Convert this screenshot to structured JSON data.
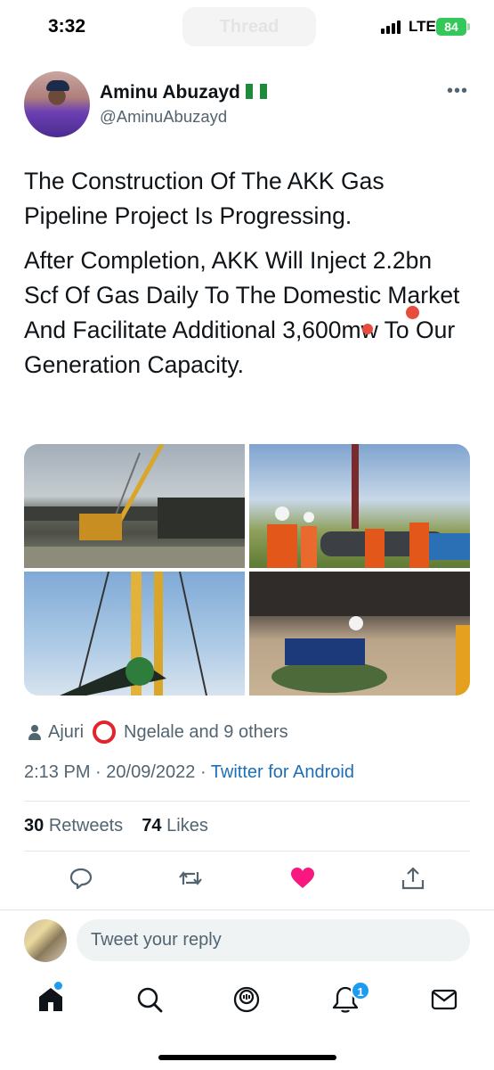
{
  "status_bar": {
    "time": "3:32",
    "faded_title": "Thread",
    "network": "LTE",
    "battery": "84"
  },
  "tweet": {
    "author_name": "Aminu Abuzayd",
    "author_handle": "@AminuAbuzayd",
    "flag_icon": "nigeria-flag-icon",
    "text_p1": "The Construction Of The AKK Gas Pipeline Project Is Progressing.",
    "text_p2": "After Completion, AKK Will Inject 2.2bn Scf Of Gas Daily To The Domestic Market And Facilitate Additional 3,600mw To Our Generation Capacity.",
    "media_count": 4,
    "liked_by_a": "Ajuri",
    "liked_by_b": "Ngelale and 9 others",
    "time": "2:13 PM",
    "date": "20/09/2022",
    "source": "Twitter for Android",
    "retweets_count": "30",
    "retweets_label": "Retweets",
    "likes_count": "74",
    "likes_label": "Likes"
  },
  "actions": [
    "reply-icon",
    "retweet-icon",
    "heart-icon",
    "share-icon"
  ],
  "reply": {
    "placeholder": "Tweet your reply"
  },
  "tabbar": {
    "notifications_badge": "1",
    "tabs": [
      "home-icon",
      "search-icon",
      "spaces-icon",
      "notifications-icon",
      "messages-icon"
    ]
  },
  "colors": {
    "accent": "#1d9bf0",
    "like": "#f91880",
    "secondary_text": "#536471",
    "battery": "#34c759"
  }
}
